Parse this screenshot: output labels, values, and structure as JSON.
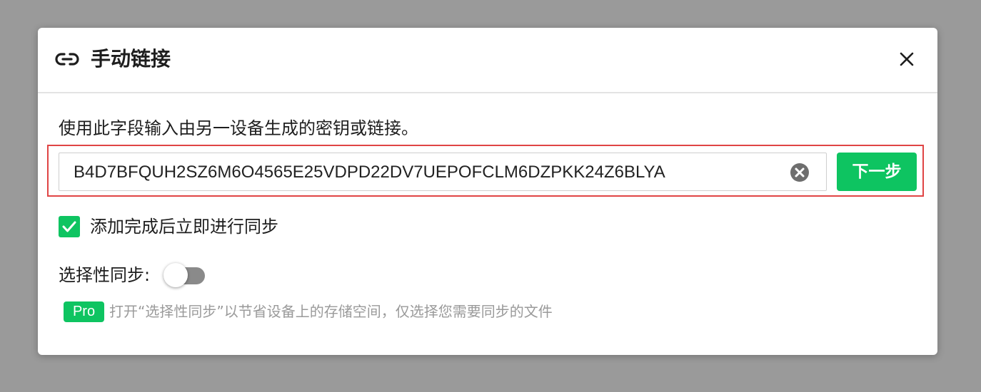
{
  "dialog": {
    "title": "手动链接",
    "icon": "link-icon",
    "close_icon": "close-icon"
  },
  "instruction": "使用此字段输入由另一设备生成的密钥或链接。",
  "key_input": {
    "value": "B4D7BFQUH2SZ6M6O4565E25VDPD22DV7UEPOFCLM6DZPKK24Z6BLYA",
    "clear_icon": "clear-circle-icon"
  },
  "next_button": {
    "label": "下一步"
  },
  "sync_after_add": {
    "label": "添加完成后立即进行同步",
    "checked": true
  },
  "selective_sync": {
    "label": "选择性同步:",
    "enabled": false
  },
  "pro_hint": {
    "badge": "Pro",
    "text": "打开“选择性同步”以节省设备上的存储空间，仅选择您需要同步的文件"
  },
  "colors": {
    "accent": "#0ec461",
    "highlight_border": "#e04545",
    "overlay": "#9a9a9a"
  }
}
